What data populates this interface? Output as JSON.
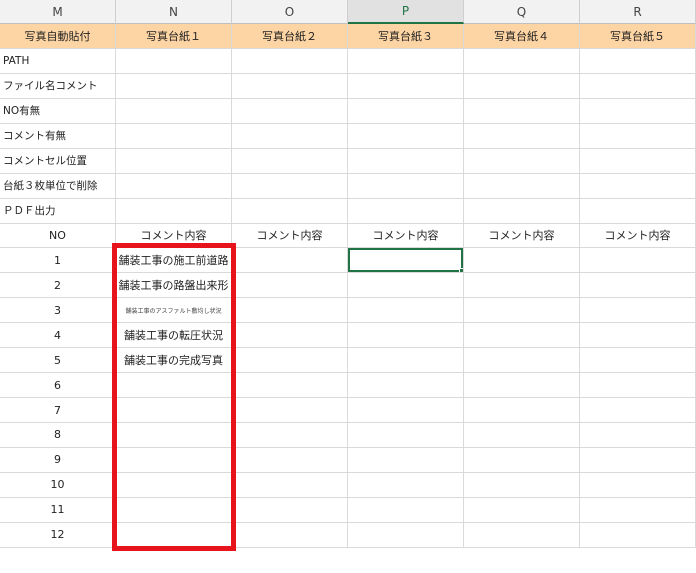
{
  "columns": [
    "M",
    "N",
    "O",
    "P",
    "Q",
    "R"
  ],
  "active_column": "P",
  "header_row": [
    "写真自動貼付",
    "写真台紙１",
    "写真台紙２",
    "写真台紙３",
    "写真台紙４",
    "写真台紙５"
  ],
  "settings_labels": [
    "PATH",
    "ファイル名コメント",
    "NO有無",
    "コメント有無",
    "コメントセル位置",
    "台紙３枚単位で削除",
    "ＰＤＦ出力"
  ],
  "no_header": "NO",
  "comment_header": "コメント内容",
  "rows": [
    {
      "no": "1",
      "comment": "舗装工事の施工前道路"
    },
    {
      "no": "2",
      "comment": "舗装工事の路盤出来形"
    },
    {
      "no": "3",
      "comment": "舗装工事のアスファルト敷均し状況"
    },
    {
      "no": "4",
      "comment": "舗装工事の転圧状況"
    },
    {
      "no": "5",
      "comment": "舗装工事の完成写真"
    },
    {
      "no": "6",
      "comment": ""
    },
    {
      "no": "7",
      "comment": ""
    },
    {
      "no": "8",
      "comment": ""
    },
    {
      "no": "9",
      "comment": ""
    },
    {
      "no": "10",
      "comment": ""
    },
    {
      "no": "11",
      "comment": ""
    },
    {
      "no": "12",
      "comment": ""
    }
  ],
  "colors": {
    "header_fill": "#fdd4a3",
    "highlight": "#e8141b",
    "selection": "#217346"
  }
}
